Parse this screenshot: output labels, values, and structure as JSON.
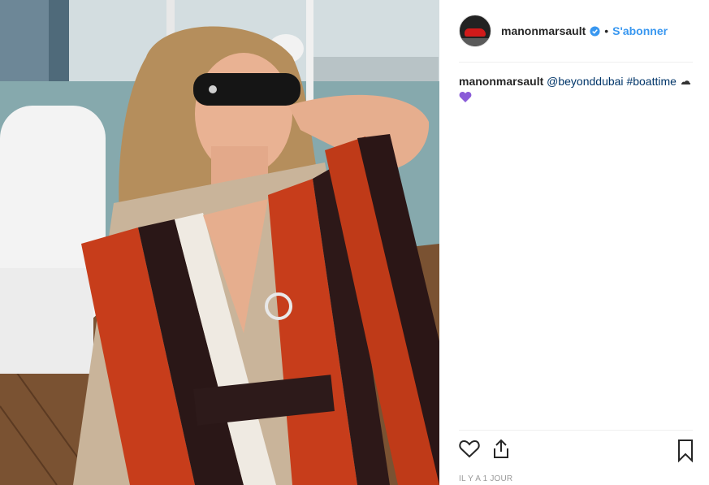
{
  "post": {
    "username": "manonmarsault",
    "separator": "•",
    "follow_label": "S'abonner",
    "caption_user": "manonmarsault",
    "caption_mention": "@beyonddubai",
    "caption_hashtag": "#boattime",
    "timestamp": "IL Y A 1 JOUR"
  },
  "icons": {
    "verified": "verified-badge-icon",
    "like": "heart-icon",
    "share": "share-icon",
    "save": "bookmark-icon",
    "emoji_1": "cloud-icon",
    "emoji_2": "purple-heart-icon"
  },
  "colors": {
    "accent": "#3897f0",
    "text": "#262626",
    "muted": "#999999",
    "link": "#003569",
    "divider": "#efefef"
  }
}
